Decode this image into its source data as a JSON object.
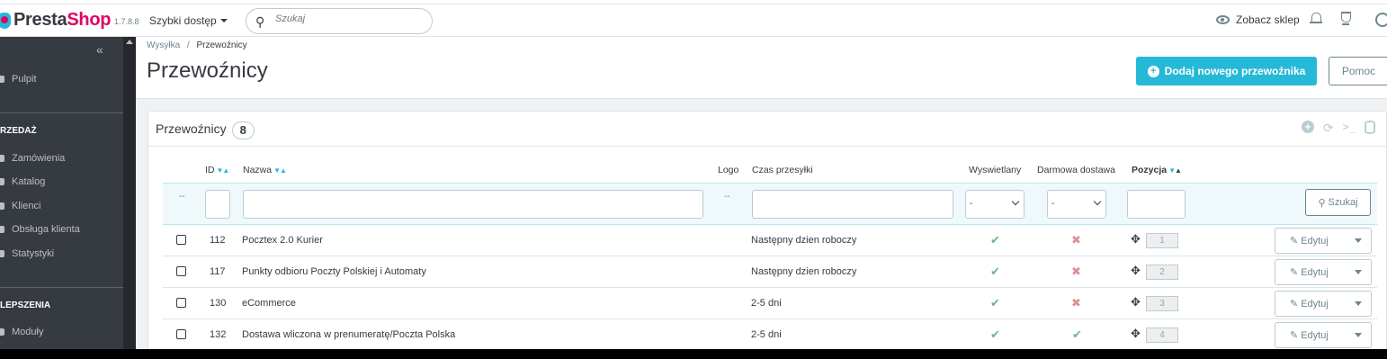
{
  "header": {
    "logo_presta": "Presta",
    "logo_shop": "Shop",
    "version": "1.7.8.8",
    "quick_access": "Szybki dostęp",
    "search_placeholder": "Szukaj",
    "view_shop": "Zobacz sklep"
  },
  "sidebar": {
    "items": [
      {
        "label": "Pulpit"
      },
      {
        "label": "Zamówienia"
      },
      {
        "label": "Katalog"
      },
      {
        "label": "Klienci"
      },
      {
        "label": "Obsługa klienta"
      },
      {
        "label": "Statystyki"
      },
      {
        "label": "Moduły"
      }
    ],
    "sections": [
      "RZEDAŻ",
      "LEPSZENIA"
    ]
  },
  "breadcrumb": {
    "parent": "Wysyłka",
    "sep": "/",
    "current": "Przewoźnicy"
  },
  "page": {
    "title": "Przewoźnicy",
    "add_button": "Dodaj nowego przewoźnika",
    "help_button": "Pomoc"
  },
  "panel": {
    "title": "Przewoźnicy",
    "count": "8"
  },
  "table": {
    "headers": {
      "id": "ID",
      "name": "Nazwa",
      "logo": "Logo",
      "delay": "Czas przesyłki",
      "active": "Wyswietlany",
      "free": "Darmowa dostawa",
      "position": "Pozycja"
    },
    "filter": {
      "dash_left": "--",
      "dash_logo": "--",
      "select_active": "-",
      "select_free": "-",
      "search_button": "Szukaj"
    },
    "rows": [
      {
        "id": "112",
        "name": "Pocztex 2.0 Kurier",
        "delay": "Następny dzien roboczy",
        "active": true,
        "free": false,
        "position": "1",
        "action": "Edytuj"
      },
      {
        "id": "117",
        "name": "Punkty odbioru Poczty Polskiej i Automaty",
        "delay": "Następny dzien roboczy",
        "active": true,
        "free": false,
        "position": "2",
        "action": "Edytuj"
      },
      {
        "id": "130",
        "name": "eCommerce",
        "delay": "2-5 dni",
        "active": true,
        "free": false,
        "position": "3",
        "action": "Edytuj"
      },
      {
        "id": "132",
        "name": "Dostawa wliczona w prenumeratę/Poczta Polska",
        "delay": "2-5 dni",
        "active": true,
        "free": true,
        "position": "4",
        "action": "Edytuj"
      }
    ]
  },
  "colors": {
    "accent": "#25b9d7",
    "brand_pink": "#df0067",
    "sidebar_bg": "#363a41",
    "ok_green": "#70b580",
    "no_red": "#e08f95"
  },
  "icons": {
    "yes": "✔",
    "no": "✖",
    "move": "✥",
    "pencil": "✎"
  }
}
